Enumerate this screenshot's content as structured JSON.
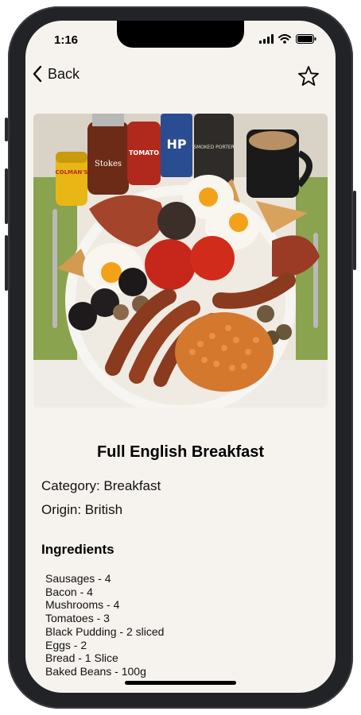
{
  "status": {
    "time": "1:16"
  },
  "nav": {
    "back_label": "Back"
  },
  "recipe": {
    "title": "Full English Breakfast",
    "category": "Category: Breakfast",
    "origin": "Origin: British"
  },
  "ingredients": {
    "heading": "Ingredients",
    "items": [
      "Sausages - 4",
      "Bacon - 4",
      "Mushrooms - 4",
      "Tomatoes - 3",
      "Black Pudding - 2 sliced",
      "Eggs - 2",
      "Bread - 1 Slice",
      "Baked Beans - 100g"
    ]
  },
  "photo": {
    "jar_label": "COLMAN'S",
    "bottle_labels": [
      "Stokes",
      "TOMATO",
      "HP",
      "SMOKED PORTER"
    ]
  },
  "colors": {
    "background": "#f6f3ef",
    "accent": "#000000"
  }
}
